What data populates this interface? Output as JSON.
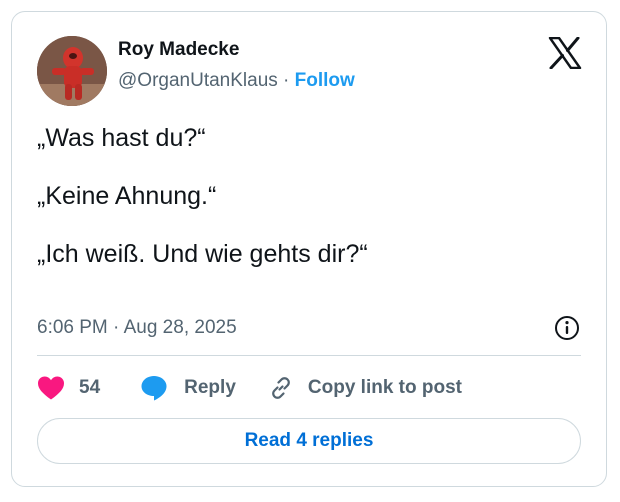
{
  "author": {
    "name": "Roy Madecke",
    "handle": "@OrganUtanKlaus",
    "separator": " · ",
    "follow_label": "Follow"
  },
  "tweet": {
    "lines": [
      "„Was hast du?“",
      "„Keine Ahnung.“",
      "„Ich weiß. Und wie gehts dir?“"
    ],
    "timestamp": "6:06 PM · Aug 28, 2025"
  },
  "actions": {
    "like_count": "54",
    "reply_label": "Reply",
    "copy_link_label": "Copy link to post"
  },
  "read_replies_label": "Read 4 replies",
  "icons": {
    "brand": "x-logo-icon",
    "info": "info-icon",
    "like": "heart-icon",
    "reply": "speech-bubble-icon",
    "copy": "link-icon"
  },
  "colors": {
    "like": "#f91880",
    "reply": "#1d9bf0",
    "follow": "#1d9bf0",
    "read_replies": "#006fd6",
    "secondary_text": "#536471",
    "border": "#cfd9de"
  }
}
